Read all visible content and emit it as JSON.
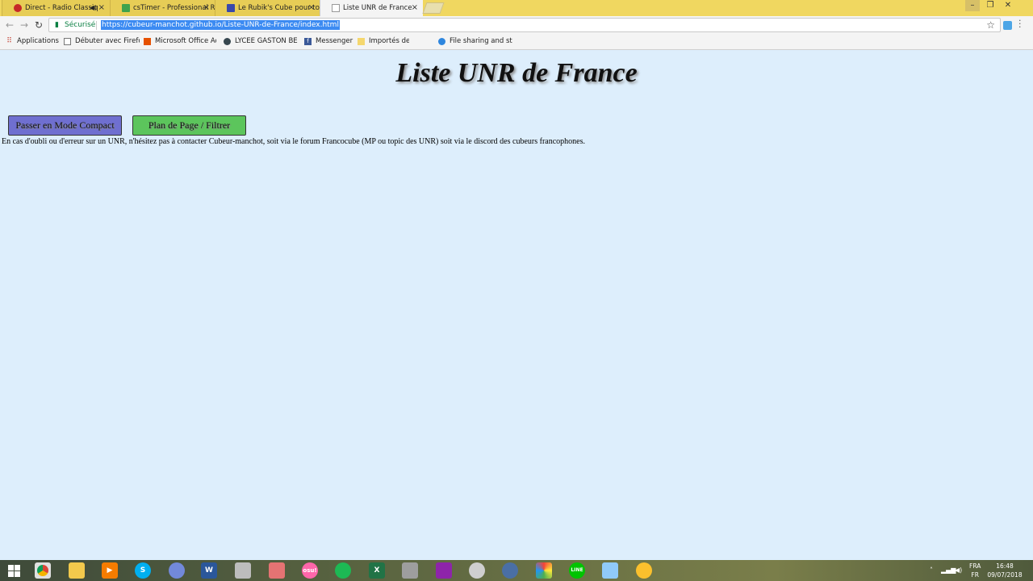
{
  "browser": {
    "tabs": [
      {
        "label": "Direct - Radio Classiq",
        "icon": "radio-icon",
        "color": "#c62828",
        "muted_icon": "speaker-icon"
      },
      {
        "label": "csTimer - Professional Ru",
        "icon": "cstimer-icon",
        "color": "#3fa34d"
      },
      {
        "label": "Le Rubik's Cube pour tou",
        "icon": "cube-icon",
        "color": "#3949ab"
      },
      {
        "label": "Liste UNR de France",
        "icon": "page-icon",
        "color": "#999999",
        "active": true
      }
    ],
    "close_glyph": "×",
    "url": "https://cubeur-manchot.github.io/Liste-UNR-de-France/index.html",
    "secure_label": "Sécurisé"
  },
  "bookmarks": [
    {
      "label": "Applications",
      "icon": "apps-grid-icon"
    },
    {
      "label": "Débuter avec Firefox",
      "icon": "page-icon"
    },
    {
      "label": "Microsoft Office Acc",
      "icon": "office-icon"
    },
    {
      "label": "LYCEE GASTON BER",
      "icon": "school-icon"
    },
    {
      "label": "Messenger",
      "icon": "facebook-icon"
    },
    {
      "label": "Importés depuis Fire",
      "icon": "folder-icon"
    },
    {
      "label": "File sharing and stor",
      "icon": "wetransfer-icon"
    }
  ],
  "page": {
    "title": "Liste UNR de France",
    "compact_button": "Passer en Mode Compact",
    "plan_button": "Plan de Page / Filtrer",
    "notice": "En cas d'oubli ou d'erreur sur un UNR, n'hésitez pas à contacter Cubeur-manchot, soit via le forum Francocube (MP ou topic des UNR) soit via le discord des cubeurs francophones."
  },
  "taskbar": {
    "language_top": "FRA",
    "language_bottom": "FR",
    "time": "16:48",
    "date": "09/07/2018",
    "apps": [
      "chrome-icon",
      "file-explorer-icon",
      "media-player-icon",
      "skype-icon",
      "discord-icon",
      "word-icon",
      "paint-icon",
      "app-icon",
      "osu-icon",
      "spotify-icon",
      "excel-icon",
      "app-icon",
      "winrar-icon",
      "app-icon",
      "app-icon",
      "app-icon",
      "line-icon",
      "app-icon",
      "app-icon"
    ]
  },
  "colors": {
    "tabstrip": "#f0d760",
    "page_background": "#ddeefc",
    "compact_button": "#6f6fd0",
    "plan_button": "#5cc55c"
  }
}
